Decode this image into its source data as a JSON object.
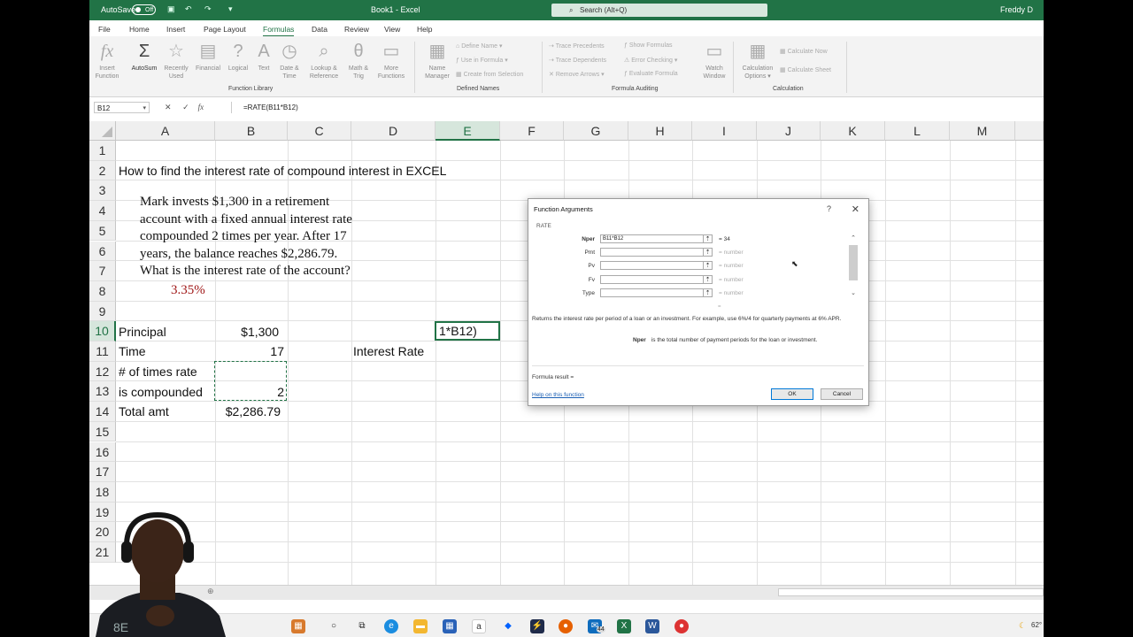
{
  "titlebar": {
    "autosave_label": "AutoSave",
    "autosave_state": "Off",
    "doc_title": "Book1 - Excel",
    "search_placeholder": "Search (Alt+Q)",
    "user_name": "Freddy D"
  },
  "tabs": [
    "File",
    "Home",
    "Insert",
    "Page Layout",
    "Formulas",
    "Data",
    "Review",
    "View",
    "Help"
  ],
  "active_tab": "Formulas",
  "ribbon": {
    "insert_function": [
      "Insert",
      "Function"
    ],
    "autosum": "AutoSum",
    "recently_used": [
      "Recently",
      "Used"
    ],
    "financial": "Financial",
    "logical": "Logical",
    "text": "Text",
    "date_time": [
      "Date &",
      "Time"
    ],
    "lookup_reference": [
      "Lookup &",
      "Reference"
    ],
    "math_trig": [
      "Math &",
      "Trig"
    ],
    "more_functions": [
      "More",
      "Functions"
    ],
    "function_library_label": "Function Library",
    "name_manager": [
      "Name",
      "Manager"
    ],
    "define_name": "Define Name",
    "use_in_formula": "Use in Formula",
    "create_from_selection": "Create from Selection",
    "defined_names_label": "Defined Names",
    "trace_precedents": "Trace Precedents",
    "trace_dependents": "Trace Dependents",
    "remove_arrows": "Remove Arrows",
    "show_formulas": "Show Formulas",
    "error_checking": "Error Checking",
    "evaluate_formula": "Evaluate Formula",
    "watch_window": [
      "Watch",
      "Window"
    ],
    "formula_auditing_label": "Formula Auditing",
    "calculation_options": [
      "Calculation",
      "Options"
    ],
    "calculate_now": "Calculate Now",
    "calculate_sheet": "Calculate Sheet",
    "calculation_label": "Calculation"
  },
  "formula_bar": {
    "name_box": "B12",
    "formula": "=RATE(B11*B12)"
  },
  "sheet": {
    "columns": [
      "A",
      "B",
      "C",
      "D",
      "E",
      "F",
      "G",
      "H",
      "I",
      "J",
      "K",
      "L",
      "M"
    ],
    "selected_column": "E",
    "rows": [
      "1",
      "2",
      "3",
      "4",
      "5",
      "6",
      "7",
      "8",
      "9",
      "10",
      "11",
      "12",
      "13",
      "14",
      "15",
      "16",
      "17",
      "18",
      "19",
      "20",
      "21"
    ],
    "selected_row": "10",
    "title": "How to find the interest rate of compound interest in EXCEL",
    "problem_lines": [
      "Mark invests $1,300 in a retirement",
      "account with a fixed annual interest rate",
      "compounded 2 times per year.  After 17",
      "years, the balance reaches $2,286.79.",
      "What is the interest rate of the account?"
    ],
    "answer": "3.35%",
    "principal_label": "Principal",
    "principal_value": "$1,300",
    "time_label": "Time",
    "time_value": "17",
    "times_label_1": "# of times rate",
    "times_label_2": "is compounded",
    "times_value": "2",
    "total_label": "Total amt",
    "total_value": "$2,286.79",
    "interest_rate_label": "Interest Rate",
    "active_cell_text": "1*B12)"
  },
  "dialog": {
    "title": "Function Arguments",
    "help_glyph": "?",
    "close_glyph": "✕",
    "function_name": "RATE",
    "args": [
      {
        "label": "Nper",
        "value": "B11*B12",
        "result": "= 34"
      },
      {
        "label": "Pmt",
        "value": "",
        "result": "= number"
      },
      {
        "label": "Pv",
        "value": "",
        "result": "= number"
      },
      {
        "label": "Fv",
        "value": "",
        "result": "= number"
      },
      {
        "label": "Type",
        "value": "",
        "result": "= number"
      }
    ],
    "equals_sign": "=",
    "description": "Returns the interest rate per period of a loan or an investment. For example, use 6%/4 for quarterly payments at 6% APR.",
    "arg_name": "Nper",
    "arg_description": "is the total number of payment periods for the loan or investment.",
    "formula_result": "Formula result =",
    "help_link": "Help on this function",
    "ok_label": "OK",
    "cancel_label": "Cancel"
  },
  "taskbar": {
    "mail_badge": "44",
    "weather_temp": "62°"
  }
}
